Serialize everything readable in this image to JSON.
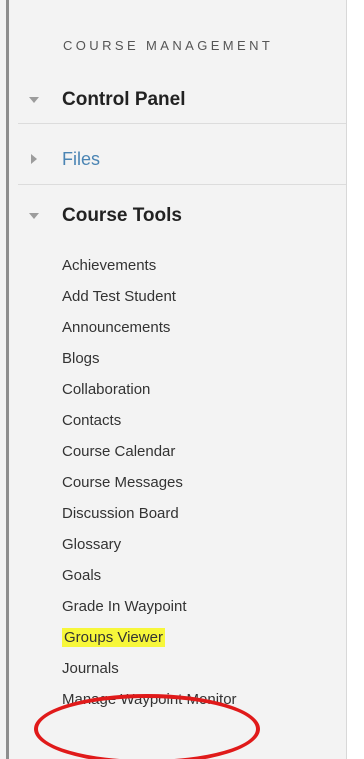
{
  "sidebar": {
    "heading": "COURSE MANAGEMENT",
    "control_panel": {
      "label": "Control Panel",
      "icon": "triangle-down-icon"
    },
    "files": {
      "label": "Files",
      "icon": "triangle-right-icon"
    },
    "course_tools": {
      "label": "Course Tools",
      "icon": "triangle-down-icon",
      "items": [
        {
          "label": "Achievements"
        },
        {
          "label": "Add Test Student"
        },
        {
          "label": "Announcements"
        },
        {
          "label": "Blogs"
        },
        {
          "label": "Collaboration"
        },
        {
          "label": "Contacts"
        },
        {
          "label": "Course Calendar"
        },
        {
          "label": "Course Messages"
        },
        {
          "label": "Discussion Board"
        },
        {
          "label": "Glossary"
        },
        {
          "label": "Goals"
        },
        {
          "label": "Grade In Waypoint"
        },
        {
          "label": "Groups Viewer",
          "highlighted": true
        },
        {
          "label": "Journals"
        },
        {
          "label": "Manage Waypoint Monitor"
        }
      ]
    }
  },
  "annotation": {
    "target": "Groups Viewer",
    "circle_color": "#e01a1a",
    "highlight_color": "#f7f73a"
  },
  "colors": {
    "panel_background": "#f3f3f3",
    "link": "#4a84b3",
    "text": "#333333"
  }
}
